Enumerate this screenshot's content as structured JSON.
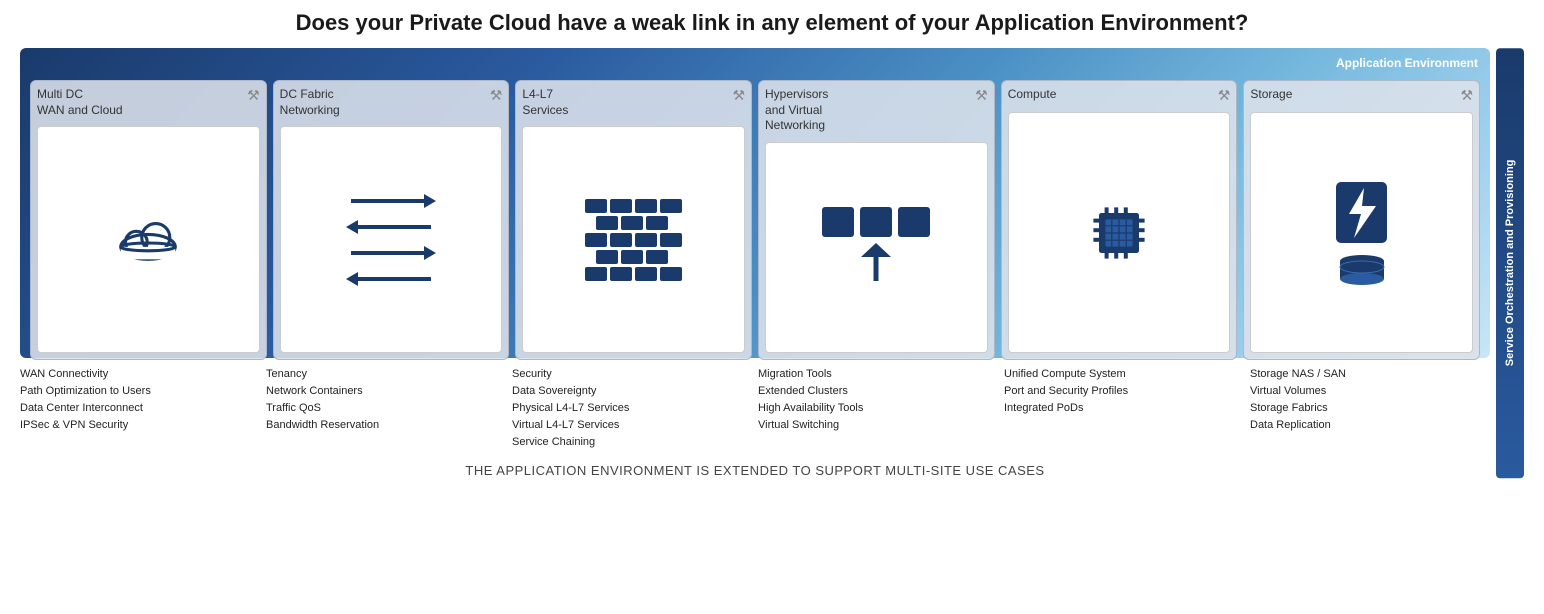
{
  "title": "Does your Private Cloud have a weak link in any element of your Application Environment?",
  "appEnvLabel": "Application Environment",
  "sideLabel": "Service Orchestration and Provisioning",
  "footer": "THE APPLICATION ENVIRONMENT IS EXTENDED TO SUPPORT MULTI-SITE USE CASES",
  "cards": [
    {
      "id": "multi-dc",
      "title": "Multi DC\nWAN and Cloud",
      "icon": "cloud"
    },
    {
      "id": "dc-fabric",
      "title": "DC Fabric\nNetworking",
      "icon": "arrows"
    },
    {
      "id": "l4-l7",
      "title": "L4-L7\nServices",
      "icon": "firewall"
    },
    {
      "id": "hypervisors",
      "title": "Hypervisors\nand Virtual\nNetworking",
      "icon": "vm"
    },
    {
      "id": "compute",
      "title": "Compute",
      "icon": "cpu"
    },
    {
      "id": "storage",
      "title": "Storage",
      "icon": "storage"
    }
  ],
  "textSections": [
    {
      "id": "multi-dc-text",
      "lines": [
        "WAN Connectivity",
        "Path Optimization to Users",
        "Data Center Interconnect",
        "IPSec & VPN Security"
      ]
    },
    {
      "id": "dc-fabric-text",
      "lines": [
        "Tenancy",
        "Network Containers",
        "Traffic QoS",
        "Bandwidth Reservation"
      ]
    },
    {
      "id": "l4-l7-text",
      "lines": [
        "Security",
        "Data Sovereignty",
        "Physical  L4-L7 Services",
        "Virtual    L4-L7 Services",
        "Service Chaining"
      ]
    },
    {
      "id": "hypervisors-text",
      "lines": [
        "Migration Tools",
        "Extended Clusters",
        "High Availability Tools",
        "Virtual Switching"
      ]
    },
    {
      "id": "compute-text",
      "lines": [
        "Unified Compute System",
        "Port and Security Profiles",
        "Integrated PoDs"
      ]
    },
    {
      "id": "storage-text",
      "lines": [
        "Storage NAS / SAN",
        "Virtual Volumes",
        "Storage Fabrics",
        "Data Replication"
      ]
    }
  ]
}
